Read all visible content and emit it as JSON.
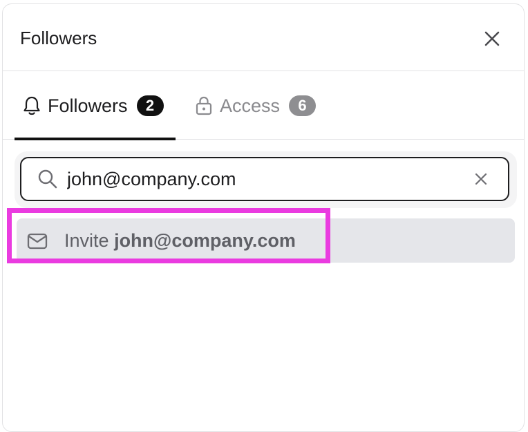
{
  "header": {
    "title": "Followers",
    "close_icon": "close-icon"
  },
  "tabs": [
    {
      "label": "Followers",
      "count": "2",
      "icon": "bell-icon",
      "active": true
    },
    {
      "label": "Access",
      "count": "6",
      "icon": "lock-icon",
      "active": false
    }
  ],
  "search": {
    "value": "john@company.com",
    "icon": "search-icon",
    "clear_icon": "clear-icon"
  },
  "invite": {
    "prefix": "Invite",
    "email": "john@company.com",
    "icon": "mail-icon"
  },
  "colors": {
    "highlight": "#ea3be0",
    "active_tab": "#111111",
    "inactive_tab": "#8a8a8e",
    "invite_row_bg": "#e5e6ea"
  }
}
